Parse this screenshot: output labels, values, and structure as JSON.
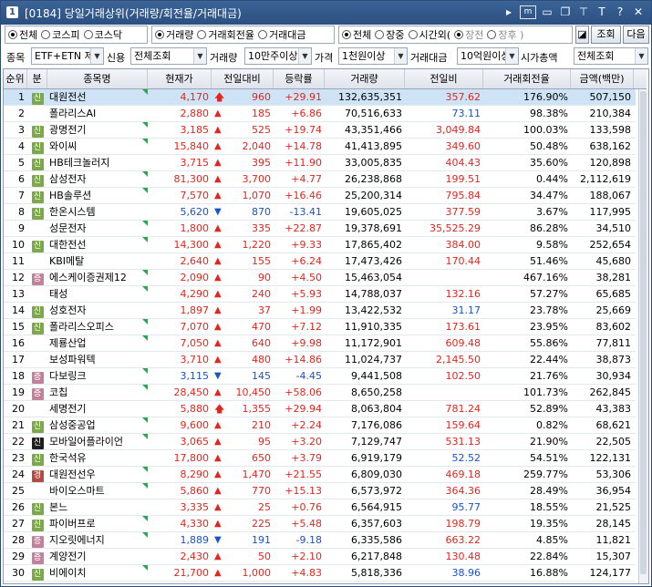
{
  "window": {
    "num": "1",
    "title": "[0184] 당일거래상위(거래량/회전율/거래대금)",
    "icons": [
      "dropdown-arrow-icon",
      "m-icon",
      "window-icon",
      "copy-icon",
      "pin-icon",
      "font-icon",
      "help-icon",
      "close-icon"
    ]
  },
  "toolbar": {
    "market": [
      {
        "label": "전체",
        "on": true
      },
      {
        "label": "코스피",
        "on": false
      },
      {
        "label": "코스닥",
        "on": false
      }
    ],
    "sort": [
      {
        "label": "거래량",
        "on": true
      },
      {
        "label": "거래회전율",
        "on": false
      },
      {
        "label": "거래대금",
        "on": false
      }
    ],
    "session": [
      {
        "label": "전체",
        "on": true
      },
      {
        "label": "장중",
        "on": false
      },
      {
        "label": "시간외(",
        "on": false,
        "dim": false
      },
      {
        "label": "장전",
        "on": true,
        "dim": true
      },
      {
        "label": "장후 )",
        "on": false,
        "dim": true
      }
    ],
    "query_button": "조회",
    "next_button": "다음"
  },
  "filters": {
    "item_label": "종목",
    "item_value": "ETF+ETN 제",
    "credit_label": "신용",
    "credit_value": "전체조회",
    "volume_label": "거래량",
    "volume_value": "10만주이상",
    "price_label": "가격",
    "price_value": "1천원이상",
    "amount_label": "거래대금",
    "amount_value": "10억원이상",
    "mcap_label": "시가총액",
    "mcap_value": "전체조회"
  },
  "table": {
    "headers": [
      "순위",
      "분",
      "종목명",
      "현재가",
      "전일대비",
      "등락률",
      "거래량",
      "전일비",
      "거래회전율",
      "금액(백만)"
    ],
    "rows": [
      {
        "rank": "1",
        "tag": "신",
        "name": "대원전선",
        "price": "4,170",
        "dir": "up-arrow",
        "chg": "960",
        "rate": "+29.91",
        "vol": "132,635,351",
        "prev": "357.62",
        "prevc": "up",
        "turn": "176.90%",
        "amt": "507,150"
      },
      {
        "rank": "2",
        "tag": "",
        "name": "폴라리스AI",
        "price": "2,880",
        "dir": "up",
        "chg": "185",
        "rate": "+6.86",
        "vol": "70,516,633",
        "prev": "73.11",
        "prevc": "dn",
        "turn": "98.38%",
        "amt": "210,384"
      },
      {
        "rank": "3",
        "tag": "신",
        "name": "광명전기",
        "price": "3,185",
        "dir": "up",
        "chg": "525",
        "rate": "+19.74",
        "vol": "43,351,466",
        "prev": "3,049.84",
        "prevc": "up",
        "turn": "100.03%",
        "amt": "133,598"
      },
      {
        "rank": "4",
        "tag": "신",
        "name": "와이씨",
        "price": "15,840",
        "dir": "up",
        "chg": "2,040",
        "rate": "+14.78",
        "vol": "41,413,895",
        "prev": "349.60",
        "prevc": "up",
        "turn": "50.48%",
        "amt": "638,162"
      },
      {
        "rank": "5",
        "tag": "신",
        "name": "HB테크놀러지",
        "price": "3,715",
        "dir": "up",
        "chg": "395",
        "rate": "+11.90",
        "vol": "33,005,835",
        "prev": "404.43",
        "prevc": "up",
        "turn": "35.60%",
        "amt": "120,898"
      },
      {
        "rank": "6",
        "tag": "신",
        "name": "삼성전자",
        "price": "81,300",
        "dir": "up",
        "chg": "3,700",
        "rate": "+4.77",
        "vol": "26,238,868",
        "prev": "199.51",
        "prevc": "up",
        "turn": "0.44%",
        "amt": "2,112,619"
      },
      {
        "rank": "7",
        "tag": "신",
        "name": "HB솔루션",
        "price": "7,570",
        "dir": "up",
        "chg": "1,070",
        "rate": "+16.46",
        "vol": "25,200,314",
        "prev": "795.84",
        "prevc": "up",
        "turn": "34.47%",
        "amt": "188,067"
      },
      {
        "rank": "8",
        "tag": "신",
        "name": "한온시스템",
        "price": "5,620",
        "dir": "dn",
        "chg": "870",
        "rate": "-13.41",
        "vol": "19,605,025",
        "prev": "377.59",
        "prevc": "up",
        "turn": "3.67%",
        "amt": "117,995"
      },
      {
        "rank": "9",
        "tag": "",
        "name": "성문전자",
        "price": "1,800",
        "dir": "up",
        "chg": "335",
        "rate": "+22.87",
        "vol": "19,378,691",
        "prev": "35,525.29",
        "prevc": "up",
        "turn": "86.28%",
        "amt": "34,510"
      },
      {
        "rank": "10",
        "tag": "신",
        "name": "대한전선",
        "price": "14,300",
        "dir": "up",
        "chg": "1,220",
        "rate": "+9.33",
        "vol": "17,865,402",
        "prev": "384.00",
        "prevc": "up",
        "turn": "9.58%",
        "amt": "252,654"
      },
      {
        "rank": "11",
        "tag": "",
        "name": "KBI메탈",
        "price": "2,640",
        "dir": "up",
        "chg": "155",
        "rate": "+6.24",
        "vol": "17,473,426",
        "prev": "170.44",
        "prevc": "up",
        "turn": "51.46%",
        "amt": "45,680"
      },
      {
        "rank": "12",
        "tag": "증",
        "name": "에스케이증권제12",
        "price": "2,090",
        "dir": "up",
        "chg": "90",
        "rate": "+4.50",
        "vol": "15,463,054",
        "prev": "",
        "prevc": "up",
        "turn": "467.16%",
        "amt": "38,281"
      },
      {
        "rank": "13",
        "tag": "",
        "name": "태성",
        "price": "4,290",
        "dir": "up",
        "chg": "240",
        "rate": "+5.93",
        "vol": "14,788,037",
        "prev": "132.16",
        "prevc": "up",
        "turn": "57.27%",
        "amt": "65,685"
      },
      {
        "rank": "14",
        "tag": "신",
        "name": "성호전자",
        "price": "1,897",
        "dir": "up",
        "chg": "37",
        "rate": "+1.99",
        "vol": "13,422,532",
        "prev": "31.17",
        "prevc": "dn",
        "turn": "23.78%",
        "amt": "25,669"
      },
      {
        "rank": "15",
        "tag": "신",
        "name": "폴라리스오피스",
        "price": "7,070",
        "dir": "up",
        "chg": "470",
        "rate": "+7.12",
        "vol": "11,910,335",
        "prev": "173.61",
        "prevc": "up",
        "turn": "23.95%",
        "amt": "83,602"
      },
      {
        "rank": "16",
        "tag": "",
        "name": "제룡산업",
        "price": "7,050",
        "dir": "up",
        "chg": "640",
        "rate": "+9.98",
        "vol": "11,172,901",
        "prev": "609.48",
        "prevc": "up",
        "turn": "55.86%",
        "amt": "77,811"
      },
      {
        "rank": "17",
        "tag": "",
        "name": "보성파워텍",
        "price": "3,710",
        "dir": "up",
        "chg": "480",
        "rate": "+14.86",
        "vol": "11,024,737",
        "prev": "2,145.50",
        "prevc": "up",
        "turn": "22.44%",
        "amt": "38,873"
      },
      {
        "rank": "18",
        "tag": "증",
        "name": "다보링크",
        "price": "3,115",
        "dir": "dn",
        "chg": "145",
        "rate": "-4.45",
        "vol": "9,441,508",
        "prev": "102.50",
        "prevc": "up",
        "turn": "21.76%",
        "amt": "30,934"
      },
      {
        "rank": "19",
        "tag": "증",
        "name": "코칩",
        "price": "28,450",
        "dir": "up",
        "chg": "10,450",
        "rate": "+58.06",
        "vol": "8,650,258",
        "prev": "",
        "prevc": "up",
        "turn": "101.73%",
        "amt": "262,845"
      },
      {
        "rank": "20",
        "tag": "",
        "name": "세명전기",
        "price": "5,880",
        "dir": "up-arrow",
        "chg": "1,355",
        "rate": "+29.94",
        "vol": "8,063,804",
        "prev": "781.24",
        "prevc": "up",
        "turn": "52.89%",
        "amt": "43,383"
      },
      {
        "rank": "21",
        "tag": "신",
        "name": "삼성중공업",
        "price": "9,600",
        "dir": "up",
        "chg": "210",
        "rate": "+2.24",
        "vol": "7,176,086",
        "prev": "159.64",
        "prevc": "up",
        "turn": "0.82%",
        "amt": "68,621"
      },
      {
        "rank": "22",
        "tag": "신b",
        "name": "모바일어플라이언",
        "price": "3,065",
        "dir": "up",
        "chg": "95",
        "rate": "+3.20",
        "vol": "7,129,747",
        "prev": "531.13",
        "prevc": "up",
        "turn": "21.90%",
        "amt": "22,505"
      },
      {
        "rank": "23",
        "tag": "신",
        "name": "한국석유",
        "price": "17,800",
        "dir": "up",
        "chg": "650",
        "rate": "+3.79",
        "vol": "6,919,179",
        "prev": "52.52",
        "prevc": "dn",
        "turn": "54.51%",
        "amt": "122,131"
      },
      {
        "rank": "24",
        "tag": "경",
        "name": "대원전선우",
        "price": "8,290",
        "dir": "up",
        "chg": "1,470",
        "rate": "+21.55",
        "vol": "6,809,030",
        "prev": "469.18",
        "prevc": "up",
        "turn": "259.77%",
        "amt": "53,306"
      },
      {
        "rank": "25",
        "tag": "",
        "name": "바이오스마트",
        "price": "5,860",
        "dir": "up",
        "chg": "770",
        "rate": "+15.13",
        "vol": "6,573,972",
        "prev": "364.36",
        "prevc": "up",
        "turn": "28.49%",
        "amt": "36,954"
      },
      {
        "rank": "26",
        "tag": "신",
        "name": "본느",
        "price": "3,335",
        "dir": "up",
        "chg": "25",
        "rate": "+0.76",
        "vol": "6,564,915",
        "prev": "95.77",
        "prevc": "dn",
        "turn": "18.55%",
        "amt": "21,525"
      },
      {
        "rank": "27",
        "tag": "신",
        "name": "파이버프로",
        "price": "4,330",
        "dir": "up",
        "chg": "225",
        "rate": "+5.48",
        "vol": "6,357,603",
        "prev": "198.79",
        "prevc": "up",
        "turn": "19.35%",
        "amt": "28,145"
      },
      {
        "rank": "28",
        "tag": "증",
        "name": "지오릿에너지",
        "price": "1,889",
        "dir": "dn",
        "chg": "191",
        "rate": "-9.18",
        "vol": "6,335,586",
        "prev": "663.22",
        "prevc": "up",
        "turn": "4.85%",
        "amt": "11,821"
      },
      {
        "rank": "29",
        "tag": "증",
        "name": "계양전기",
        "price": "2,430",
        "dir": "up",
        "chg": "50",
        "rate": "+2.10",
        "vol": "6,217,848",
        "prev": "130.48",
        "prevc": "up",
        "turn": "22.84%",
        "amt": "15,307"
      },
      {
        "rank": "30",
        "tag": "신",
        "name": "비에이치",
        "price": "21,700",
        "dir": "up",
        "chg": "1,000",
        "rate": "+4.83",
        "vol": "5,818,336",
        "prev": "38.96",
        "prevc": "dn",
        "turn": "16.88%",
        "amt": "124,177"
      }
    ]
  },
  "colors": {
    "up": "#e0261f",
    "down": "#1a52c9",
    "tag_credit": "#7da84a",
    "tag_credit_black": "#1e1e1e",
    "tag_caution": "#c2819a",
    "tag_warn": "#b24b43",
    "selected_row": "#cfe3f6"
  }
}
